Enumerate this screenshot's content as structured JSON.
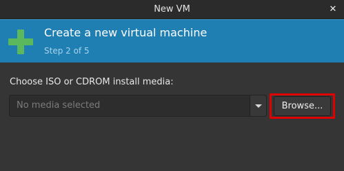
{
  "window": {
    "title": "New VM",
    "close_icon": "close-icon"
  },
  "header": {
    "icon": "plus-icon",
    "icon_color": "#5cb85c",
    "background_color": "#1f7fb3",
    "heading": "Create a new virtual machine",
    "step": "Step 2 of 5"
  },
  "media": {
    "label": "Choose ISO or CDROM install media:",
    "placeholder": "No media selected",
    "dropdown_icon": "chevron-down-icon",
    "browse_label": "Browse...",
    "highlight_color": "#e00000"
  }
}
